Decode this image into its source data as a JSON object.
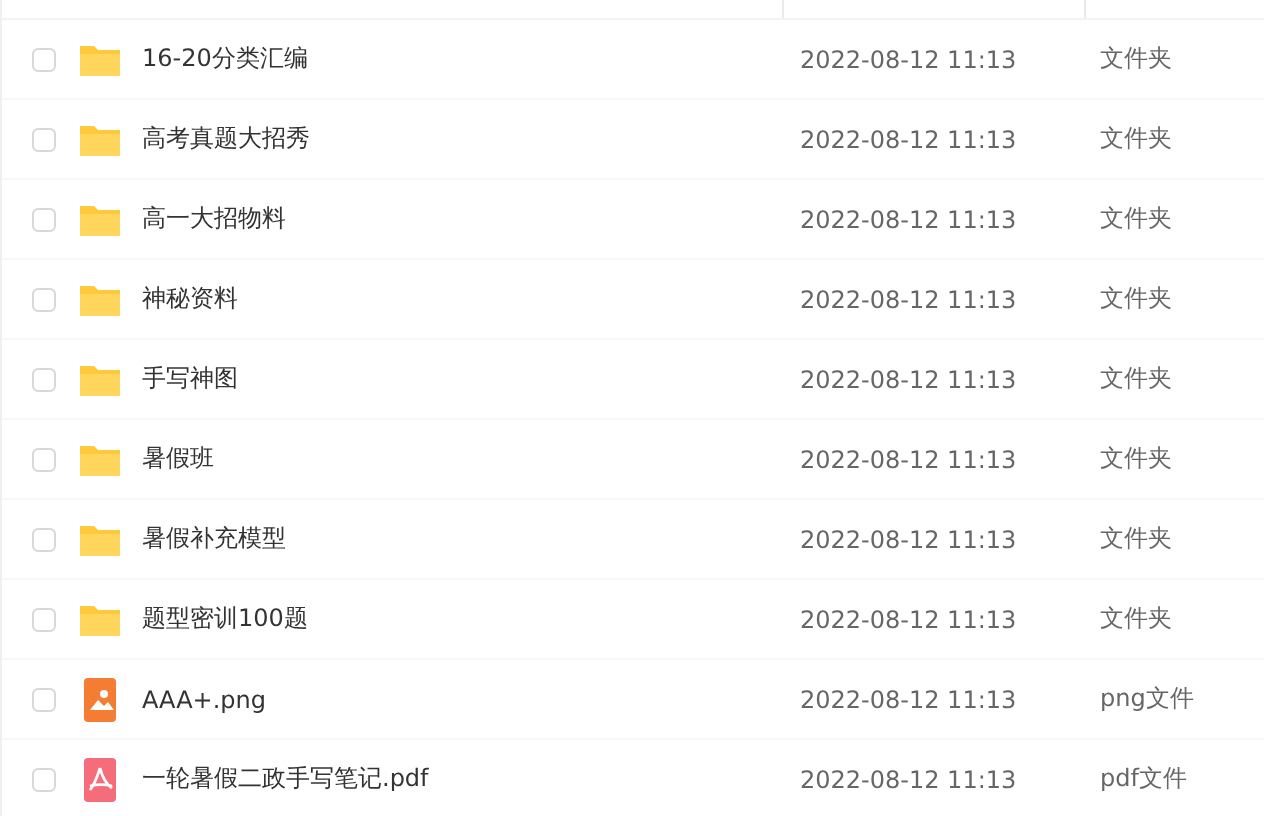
{
  "files": [
    {
      "kind": "folder",
      "name": "16-20分类汇编",
      "modified": "2022-08-12 11:13",
      "type": "文件夹",
      "checked": false
    },
    {
      "kind": "folder",
      "name": "高考真题大招秀",
      "modified": "2022-08-12 11:13",
      "type": "文件夹",
      "checked": false
    },
    {
      "kind": "folder",
      "name": "高一大招物料",
      "modified": "2022-08-12 11:13",
      "type": "文件夹",
      "checked": false
    },
    {
      "kind": "folder",
      "name": "神秘资料",
      "modified": "2022-08-12 11:13",
      "type": "文件夹",
      "checked": false
    },
    {
      "kind": "folder",
      "name": "手写神图",
      "modified": "2022-08-12 11:13",
      "type": "文件夹",
      "checked": false
    },
    {
      "kind": "folder",
      "name": "暑假班",
      "modified": "2022-08-12 11:13",
      "type": "文件夹",
      "checked": false
    },
    {
      "kind": "folder",
      "name": "暑假补充模型",
      "modified": "2022-08-12 11:13",
      "type": "文件夹",
      "checked": false
    },
    {
      "kind": "folder",
      "name": "题型密训100题",
      "modified": "2022-08-12 11:13",
      "type": "文件夹",
      "checked": false
    },
    {
      "kind": "image",
      "name": "AAA+.png",
      "modified": "2022-08-12 11:13",
      "type": "png文件",
      "checked": false
    },
    {
      "kind": "pdf",
      "name": "一轮暑假二政手写笔记.pdf",
      "modified": "2022-08-12 11:13",
      "type": "pdf文件",
      "checked": false
    }
  ]
}
